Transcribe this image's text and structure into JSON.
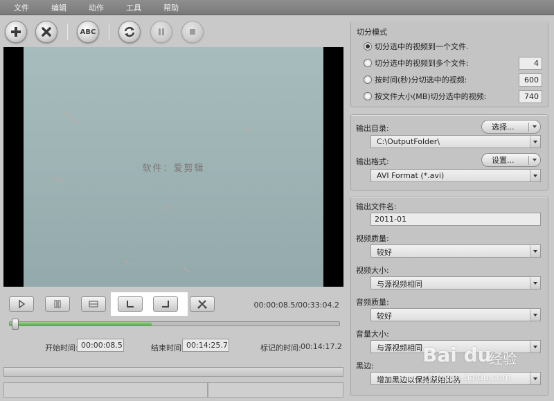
{
  "menu": [
    "文件",
    "编辑",
    "动作",
    "工具",
    "帮助"
  ],
  "toolbar": {
    "abc_label": "ABC",
    "icons": [
      "add-icon",
      "remove-icon",
      "rename-icon",
      "convert-icon",
      "pause-icon",
      "stop-icon"
    ]
  },
  "video": {
    "caption": "软件：爱剪辑"
  },
  "controls": {
    "timecode": "00:00:08.5/00:33:04.2",
    "progress": 0.43,
    "start_label": "开始时间:",
    "start_value": "00:00:08.5",
    "end_label": "结束时间:",
    "end_value": "00:14:25.7",
    "marked_label": "标记的时间:",
    "marked_value": "00:14:17.2"
  },
  "split_mode": {
    "title": "切分模式",
    "options": [
      {
        "label": "切分选中的视频到一个文件.",
        "selected": true,
        "value": ""
      },
      {
        "label": "切分选中的视频到多个文件:",
        "selected": false,
        "value": "4"
      },
      {
        "label": "按时间(秒)分切选中的视频:",
        "selected": false,
        "value": "600"
      },
      {
        "label": "按文件大小(MB)切分选中的视频:",
        "selected": false,
        "value": "740"
      }
    ]
  },
  "output": {
    "dir_label": "输出目录:",
    "choose_label": "选择...",
    "dir_value": "C:\\OutputFolder\\",
    "format_label": "输出格式:",
    "settings_label": "设置...",
    "format_value": "AVI Format (*.avi)"
  },
  "params": {
    "filename_label": "输出文件名:",
    "filename_value": "2011-01",
    "video_quality_label": "视频质量:",
    "video_quality_value": "较好",
    "video_size_label": "视频大小:",
    "video_size_value": "与源视频相同",
    "audio_quality_label": "音频质量:",
    "audio_quality_value": "较好",
    "volume_label": "音量大小:",
    "volume_value": "与源视频相同",
    "border_label": "黑边:",
    "border_value": "增加黑边以保持原始比例"
  },
  "watermark": {
    "logo": "Bai du",
    "text": "经验",
    "url": "jingyan.baidu.com"
  }
}
